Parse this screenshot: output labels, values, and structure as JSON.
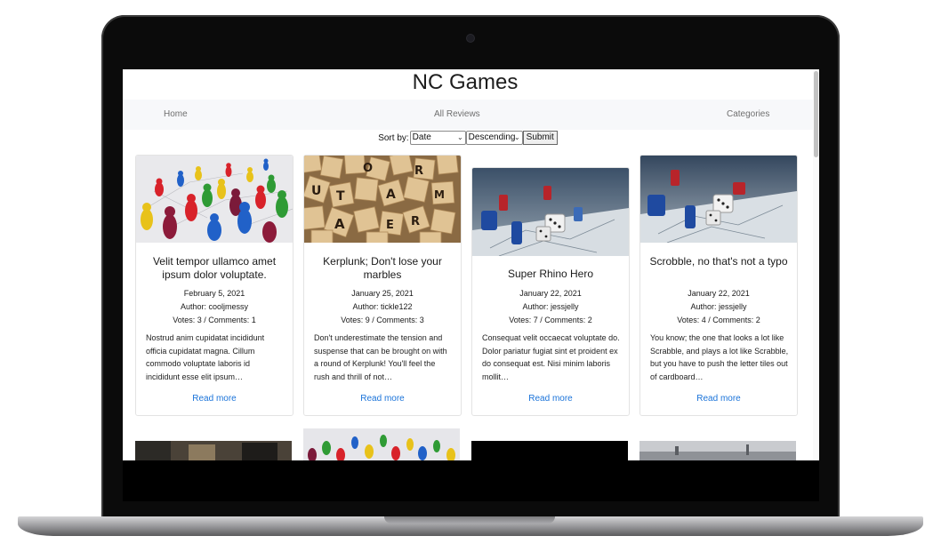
{
  "site": {
    "title": "NC Games"
  },
  "nav": {
    "home": "Home",
    "all_reviews": "All Reviews",
    "categories": "Categories"
  },
  "sort": {
    "label": "Sort by:",
    "field": "Date",
    "order": "Descending",
    "submit": "Submit"
  },
  "reviews": [
    {
      "title": "Velit tempor ullamco amet ipsum dolor voluptate.",
      "date": "February 5, 2021",
      "author": "Author: cooljmessy",
      "stats": "Votes: 3 / Comments: 1",
      "excerpt": "Nostrud anim cupidatat incididunt officia cupidatat magna. Cillum commodo voluptate laboris id incididunt esse elit ipsum…",
      "link": "Read more",
      "image": "colored-game-pieces"
    },
    {
      "title": "Kerplunk; Don't lose your marbles",
      "date": "January 25, 2021",
      "author": "Author: tickle122",
      "stats": "Votes: 9 / Comments: 3",
      "excerpt": "Don't underestimate the tension and suspense that can be brought on with a round of Kerplunk! You'll feel the rush and thrill of not…",
      "link": "Read more",
      "image": "letter-tiles"
    },
    {
      "title": "Super Rhino Hero",
      "date": "January 22, 2021",
      "author": "Author: jessjelly",
      "stats": "Votes: 7 / Comments: 2",
      "excerpt": "Consequat velit occaecat voluptate do. Dolor pariatur fugiat sint et proident ex do consequat est. Nisi minim laboris mollit…",
      "link": "Read more",
      "image": "board-game-dice"
    },
    {
      "title": "Scrobble, no that's not a typo",
      "date": "January 22, 2021",
      "author": "Author: jessjelly",
      "stats": "Votes: 4 / Comments: 2",
      "excerpt": "You know; the one that looks a lot like Scrabble, and plays a lot like Scrabble, but you have to push the letter tiles out of cardboard…",
      "link": "Read more",
      "image": "board-game-dice"
    }
  ],
  "colors": {
    "link": "#1a73d9",
    "nav_bg": "#f7f8fa",
    "frame": "#0b0b0b"
  }
}
